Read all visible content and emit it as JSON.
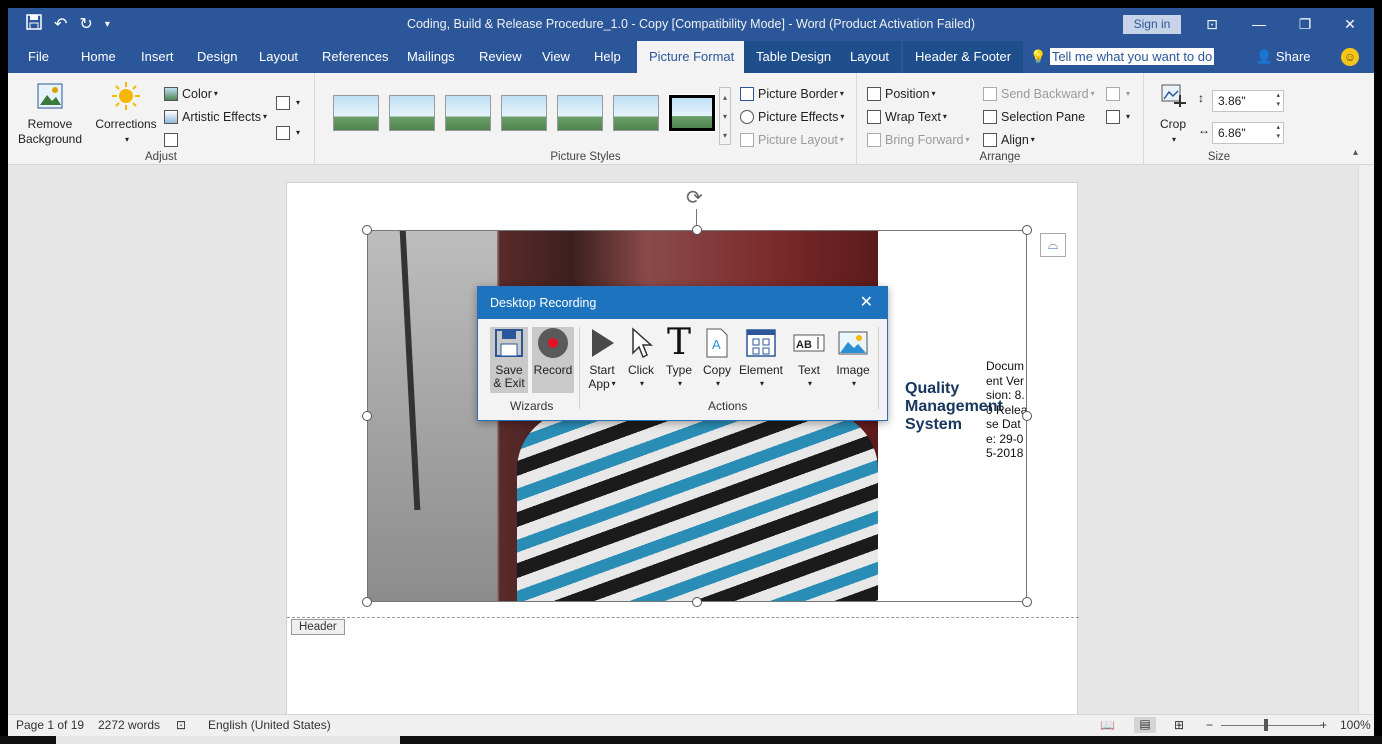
{
  "title_bar": {
    "doc_title": "Coding, Build & Release Procedure_1.0 - Copy [Compatibility Mode]  -  Word (Product Activation Failed)",
    "sign_in": "Sign in"
  },
  "tabs": [
    "File",
    "Home",
    "Insert",
    "Design",
    "Layout",
    "References",
    "Mailings",
    "Review",
    "View",
    "Help",
    "Picture Format",
    "Table Design",
    "Layout",
    "Header & Footer"
  ],
  "active_tab": "Picture Format",
  "tell_me": "Tell me what you want to do",
  "share": "Share",
  "ribbon": {
    "adjust": {
      "label": "Adjust",
      "remove_background": "Remove Background",
      "corrections": "Corrections",
      "color": "Color",
      "artistic_effects": "Artistic Effects"
    },
    "picture_styles": {
      "label": "Picture Styles",
      "picture_border": "Picture Border",
      "picture_effects": "Picture Effects",
      "picture_layout": "Picture Layout"
    },
    "arrange": {
      "label": "Arrange",
      "position": "Position",
      "wrap_text": "Wrap Text",
      "bring_forward": "Bring Forward",
      "send_backward": "Send Backward",
      "selection_pane": "Selection Pane",
      "align": "Align"
    },
    "size": {
      "label": "Size",
      "crop": "Crop",
      "height": "3.86\"",
      "width": "6.86\""
    }
  },
  "document": {
    "qms_title": "Quality Management System",
    "doc_info": "Document Version: 8.0 Release Date: 29-05-2018",
    "header_tag": "Header"
  },
  "dialog": {
    "title": "Desktop Recording",
    "wizards_label": "Wizards",
    "actions_label": "Actions",
    "buttons": {
      "save_exit": "Save & Exit",
      "record": "Record",
      "start_app": "Start App",
      "click": "Click",
      "type": "Type",
      "copy": "Copy",
      "element": "Element",
      "text": "Text",
      "image": "Image"
    }
  },
  "status_bar": {
    "page": "Page 1 of 19",
    "words": "2272 words",
    "language": "English (United States)",
    "zoom": "100%"
  },
  "colors": {
    "word_blue": "#2b579a",
    "dialog_blue": "#1e73be",
    "record_red": "#e81123"
  }
}
